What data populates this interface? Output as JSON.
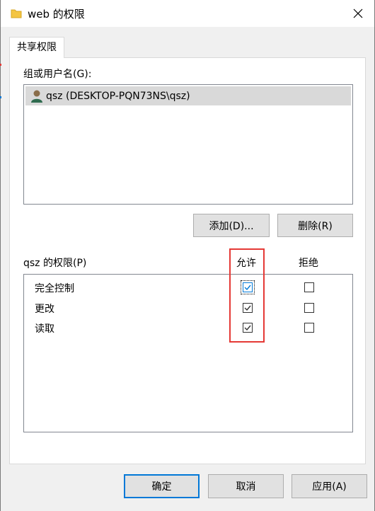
{
  "window": {
    "title": "web 的权限",
    "close_icon": "close-icon",
    "folder_icon": "folder-icon"
  },
  "tabs": [
    {
      "label": "共享权限"
    }
  ],
  "groups": {
    "label": "组或用户名(G):",
    "items": [
      {
        "name": "qsz (DESKTOP-PQN73NS\\qsz)",
        "icon": "user-icon"
      }
    ]
  },
  "group_buttons": {
    "add": "添加(D)...",
    "remove": "删除(R)"
  },
  "permissions": {
    "label": "qsz 的权限(P)",
    "allow_header": "允许",
    "deny_header": "拒绝",
    "rows": [
      {
        "name": "完全控制",
        "allow": true,
        "deny": false
      },
      {
        "name": "更改",
        "allow": true,
        "deny": false
      },
      {
        "name": "读取",
        "allow": true,
        "deny": false
      }
    ]
  },
  "footer_buttons": {
    "ok": "确定",
    "cancel": "取消",
    "apply": "应用(A)"
  },
  "colors": {
    "accent": "#0078d7",
    "highlight": "#e53935",
    "selected_row": "#d9d9d9"
  }
}
